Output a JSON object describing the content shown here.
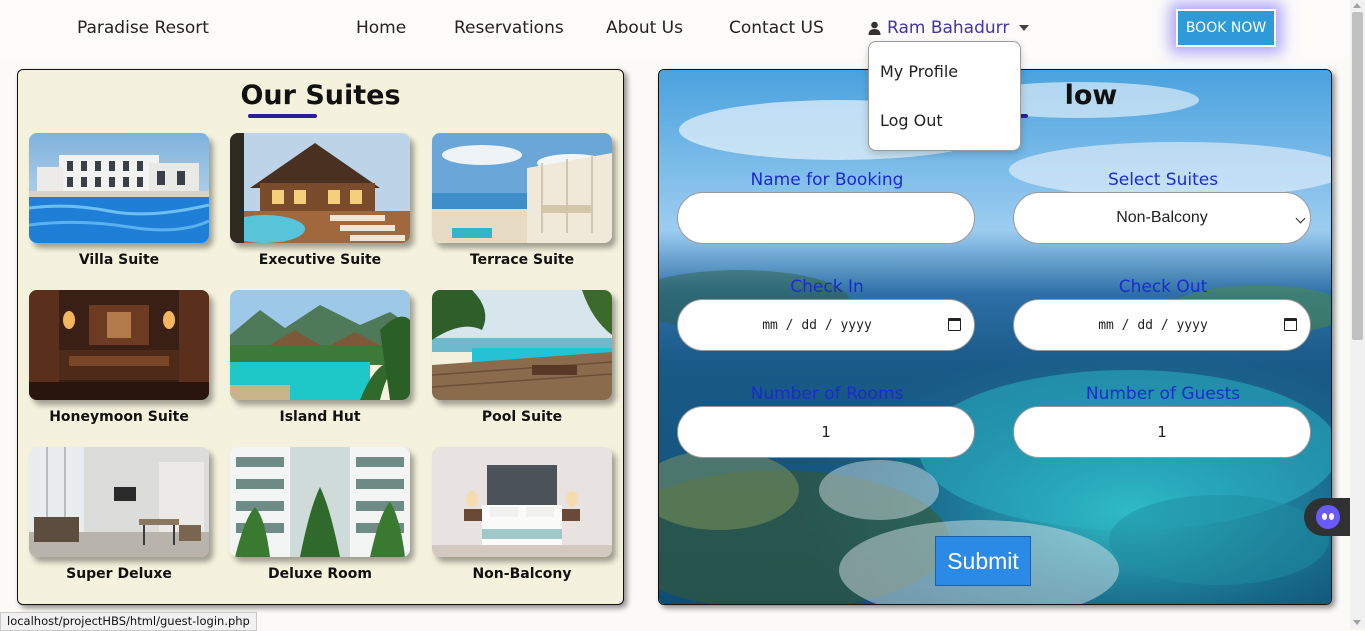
{
  "navbar": {
    "brand": "Paradise Resort",
    "links": [
      "Home",
      "Reservations",
      "About Us",
      "Contact US"
    ],
    "user_name": "Ram Bahadurr",
    "book_button": "BOOK NOW"
  },
  "user_menu": {
    "items": [
      "My Profile",
      "Log Out"
    ]
  },
  "suites": {
    "title": "Our Suites",
    "items": [
      {
        "name": "Villa Suite",
        "image": "villa-pool-photo"
      },
      {
        "name": "Executive Suite",
        "image": "wooden-lodge-pool-photo"
      },
      {
        "name": "Terrace Suite",
        "image": "beach-terrace-photo"
      },
      {
        "name": "Honeymoon Suite",
        "image": "dark-wood-lounge-photo"
      },
      {
        "name": "Island Hut",
        "image": "tropical-pool-huts-photo"
      },
      {
        "name": "Pool Suite",
        "image": "infinity-pool-deck-photo"
      },
      {
        "name": "Super Deluxe",
        "image": "modern-living-room-photo"
      },
      {
        "name": "Deluxe Room",
        "image": "courtyard-balconies-photo"
      },
      {
        "name": "Non-Balcony",
        "image": "twin-bedroom-photo"
      }
    ]
  },
  "booking": {
    "title_visible": "low",
    "fields": {
      "name_label": "Name for Booking",
      "name_value": "",
      "suite_label": "Select Suites",
      "suite_value": "Non-Balcony",
      "checkin_label": "Check In",
      "checkin_value": "mm / dd / yyyy",
      "checkout_label": "Check Out",
      "checkout_value": "mm / dd / yyyy",
      "rooms_label": "Number of Rooms",
      "rooms_value": "1",
      "guests_label": "Number of Guests",
      "guests_value": "1"
    },
    "submit_label": "Submit"
  },
  "status_bar": {
    "url": "localhost/projectHBS/html/guest-login.php"
  },
  "colors": {
    "accent_blue": "#2b8ae6",
    "label_blue": "#1a2bd0",
    "user_purple": "#3f35a8",
    "panel_bg": "#f4f2dc",
    "underline": "#2a1f9a"
  }
}
